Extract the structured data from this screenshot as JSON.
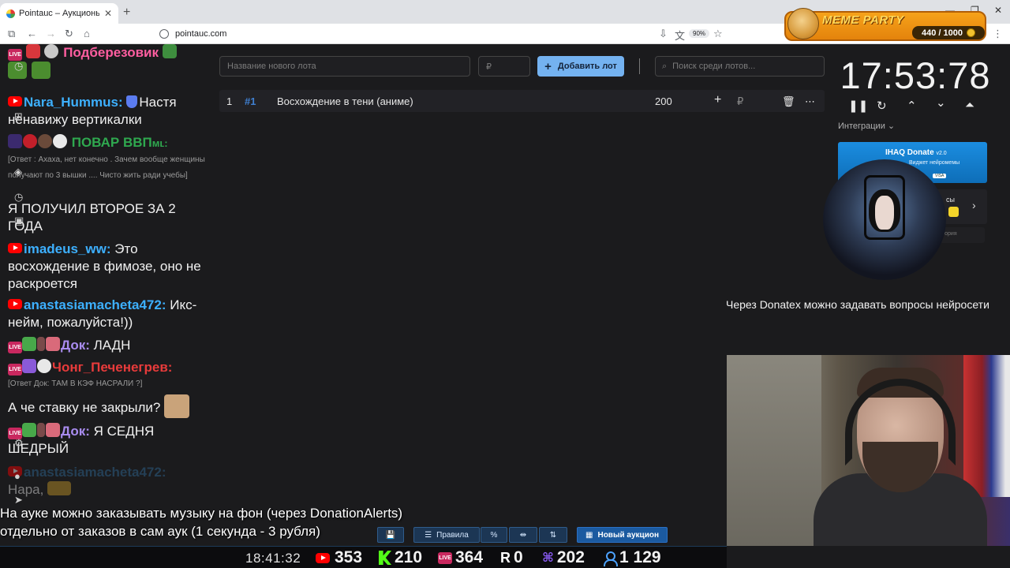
{
  "browser": {
    "tab_title": "Pointauc – Аукционы, лотерея",
    "url": "pointauc.com",
    "zoom": "90%"
  },
  "overlay": {
    "meme_title": "MEME PARTY",
    "meme_count": "440 / 1000"
  },
  "chat": {
    "messages": [
      {
        "nick": "Подберезовик",
        "nick_color": "#ff5ea0",
        "text": ""
      },
      {
        "nick": "Nara_Hummus:",
        "nick_color": "#3db0ff",
        "text": "Настя ненавижу вертикалки"
      },
      {
        "nick": "ПОВАР ВВП",
        "nick_color": "#2fa84f",
        "text": "",
        "reply": "[Ответ : Ахаха, нет конечно . Зачем вообще женщины получают по 3 вышки .... Чисто жить ради учебы]"
      },
      {
        "nick": "",
        "nick_color": "",
        "text": "Я ПОЛУЧИЛ ВТОРОЕ ЗА 2 ГОДА"
      },
      {
        "nick": "imadeus_ww:",
        "nick_color": "#3db0ff",
        "text": "Это восхождение в фимозе, оно не раскроется"
      },
      {
        "nick": "anastasiamacheta472:",
        "nick_color": "#3db0ff",
        "text": "Икс-нейм, пожалуйста!))"
      },
      {
        "nick": "Док:",
        "nick_color": "#a98cf0",
        "text": "ЛАДН"
      },
      {
        "nick": "Чонг_Печенегрев:",
        "nick_color": "#e83b3b",
        "text": "",
        "reply": "[Ответ Док: ТАМ В КЭФ НАСРАЛИ ?]"
      },
      {
        "nick": "",
        "nick_color": "",
        "text": "А че ставку не закрыли?"
      },
      {
        "nick": "Док:",
        "nick_color": "#a98cf0",
        "text": "Я СЕДНЯ ШЕДРЫЙ"
      },
      {
        "nick": "anastasiamacheta472:",
        "nick_color": "#2f6b9a",
        "text": "Нара,"
      }
    ]
  },
  "auction": {
    "new_lot_placeholder": "Название нового лота",
    "price_placeholder": "₽",
    "add_lot_label": "Добавить лот",
    "search_placeholder": "Поиск среди лотов...",
    "lots": [
      {
        "index": "1",
        "id": "#1",
        "name": "Восхождение в тени (аниме)",
        "amount": "200",
        "currency": "₽"
      }
    ],
    "toolbar": {
      "rules_label": "Правила",
      "new_auction_label": "Новый аукцион"
    }
  },
  "timer": {
    "value": "17:53:78",
    "integrations_label": "Интеграции"
  },
  "integrations": {
    "ihaq_title": "IHAQ Donate",
    "ihaq_version": "v2.0",
    "ihaq_sub": "Виджет нейромемы",
    "ihaq_payments": "VISA",
    "card_title": "сы",
    "card_sub": "тория"
  },
  "captions": {
    "donatex": "Через Donatex можно задавать вопросы нейросети",
    "line1": "На ауке можно заказывать музыку на фон (через DonationAlerts)",
    "line2": "отдельно от заказов в сам аук (1 секунда - 3 рубля)"
  },
  "stats": {
    "clock": "18:41:32",
    "youtube": "353",
    "kick": "210",
    "vk": "364",
    "rumble": "0",
    "twitch": "202",
    "total": "1 129"
  },
  "colors": {
    "accent": "#74b2f0",
    "app_bg": "#1b1b1d",
    "lot_id": "#3f7fd0"
  }
}
